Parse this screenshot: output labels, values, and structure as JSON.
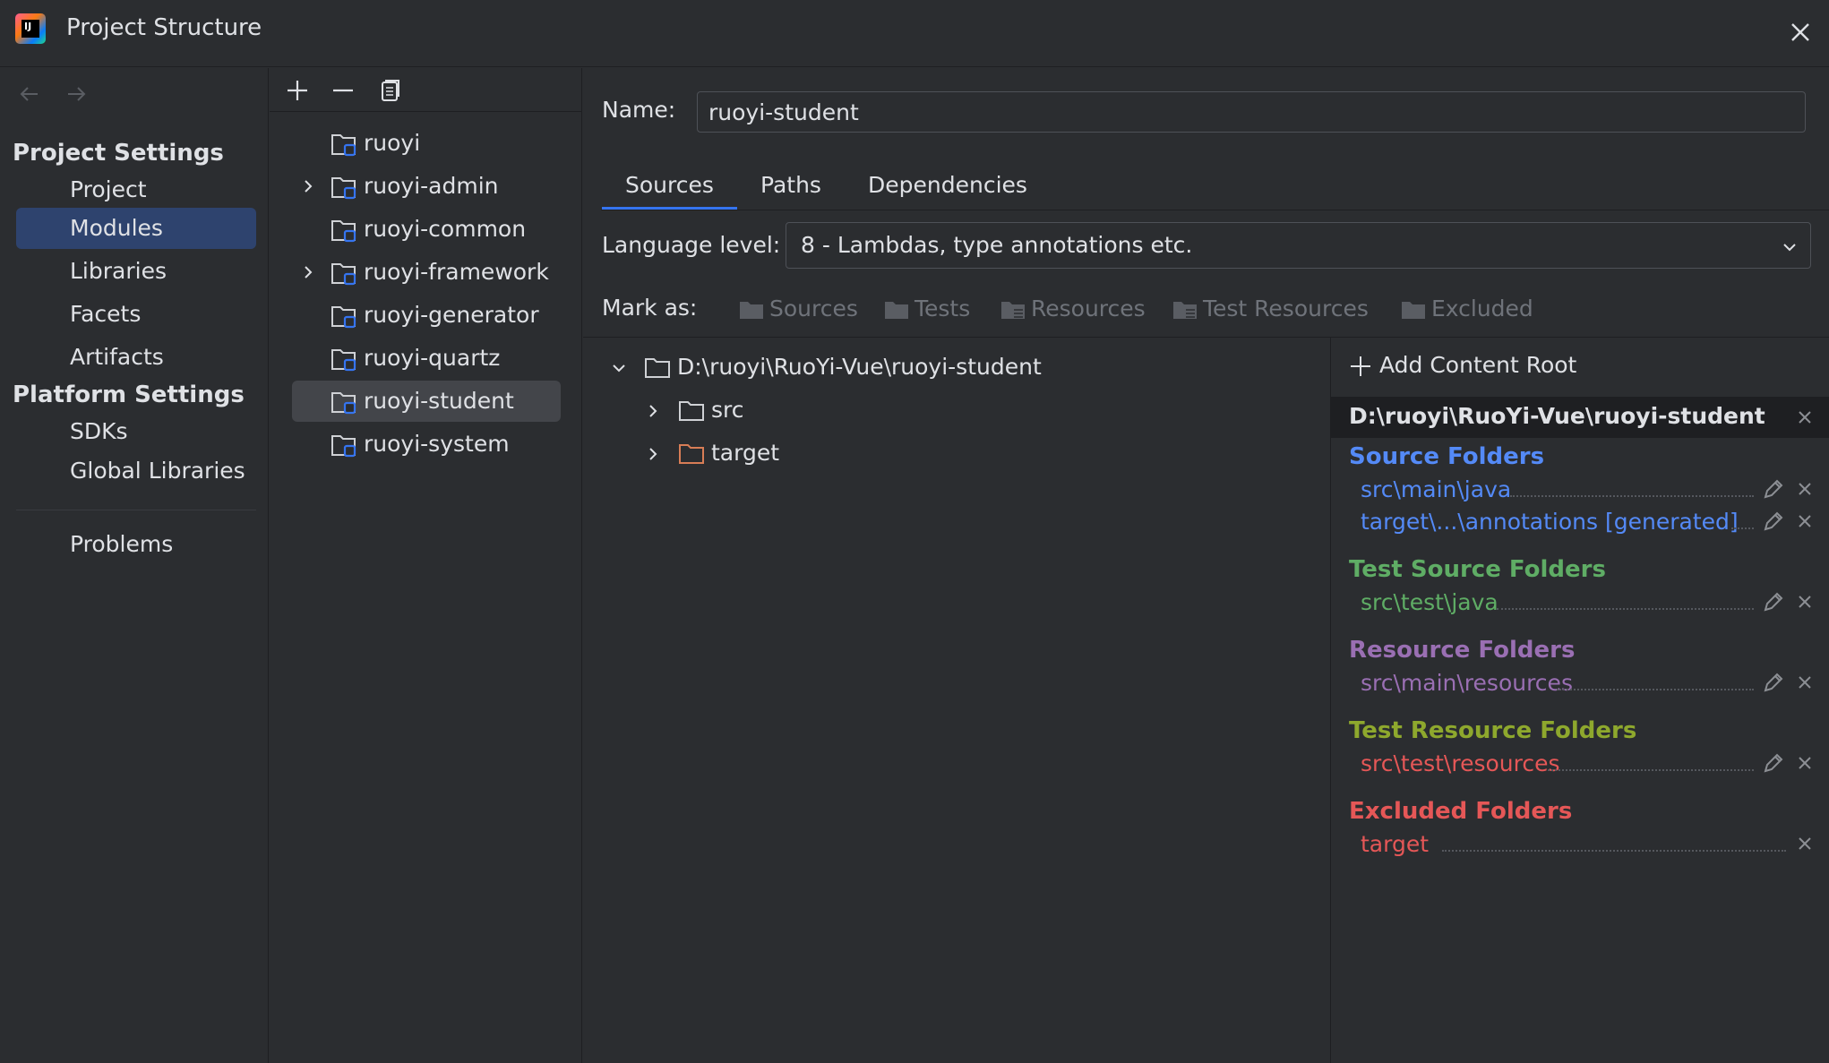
{
  "window": {
    "title": "Project Structure"
  },
  "nav": {
    "project_settings_heading": "Project Settings",
    "platform_settings_heading": "Platform Settings",
    "items": [
      "Project",
      "Modules",
      "Libraries",
      "Facets",
      "Artifacts"
    ],
    "platform_items": [
      "SDKs",
      "Global Libraries"
    ],
    "problems": "Problems",
    "selected": "Modules"
  },
  "modules": [
    {
      "label": "ruoyi",
      "expandable": false
    },
    {
      "label": "ruoyi-admin",
      "expandable": true
    },
    {
      "label": "ruoyi-common",
      "expandable": false
    },
    {
      "label": "ruoyi-framework",
      "expandable": true
    },
    {
      "label": "ruoyi-generator",
      "expandable": false
    },
    {
      "label": "ruoyi-quartz",
      "expandable": false
    },
    {
      "label": "ruoyi-student",
      "expandable": false
    },
    {
      "label": "ruoyi-system",
      "expandable": false
    }
  ],
  "selected_module": "ruoyi-student",
  "detail": {
    "name_label": "Name:",
    "name_value": "ruoyi-student",
    "tabs": [
      "Sources",
      "Paths",
      "Dependencies"
    ],
    "active_tab": "Sources",
    "language_level_label": "Language level:",
    "language_level_value": "8 - Lambdas, type annotations etc.",
    "mark_as_label": "Mark as:",
    "mark_as_buttons": [
      "Sources",
      "Tests",
      "Resources",
      "Test Resources",
      "Excluded"
    ]
  },
  "tree": {
    "root": "D:\\ruoyi\\RuoYi-Vue\\ruoyi-student",
    "children": [
      "src",
      "target"
    ]
  },
  "roots_panel": {
    "add_content_root": "Add Content Root",
    "root_path": "D:\\ruoyi\\RuoYi-Vue\\ruoyi-student",
    "source_folders_title": "Source Folders",
    "source_folders": [
      "src\\main\\java",
      "target\\...\\annotations [generated]"
    ],
    "test_source_folders_title": "Test Source Folders",
    "test_source_folders": [
      "src\\test\\java"
    ],
    "resource_folders_title": "Resource Folders",
    "resource_folders": [
      "src\\main\\resources"
    ],
    "test_resource_folders_title": "Test Resource Folders",
    "test_resource_folders": [
      "src\\test\\resources"
    ],
    "excluded_folders_title": "Excluded Folders",
    "excluded_folders": [
      "target"
    ]
  },
  "colors": {
    "background": "#2b2d30",
    "selection": "#2e436e",
    "accent": "#3574f0",
    "source": "#548af7",
    "test_source": "#5fad65",
    "resource": "#9a6fb3",
    "test_resource_title": "#8ea82d",
    "test_resource_entry": "#e55757",
    "excluded": "#e55757",
    "excluded_folder_icon": "#d87d56"
  }
}
